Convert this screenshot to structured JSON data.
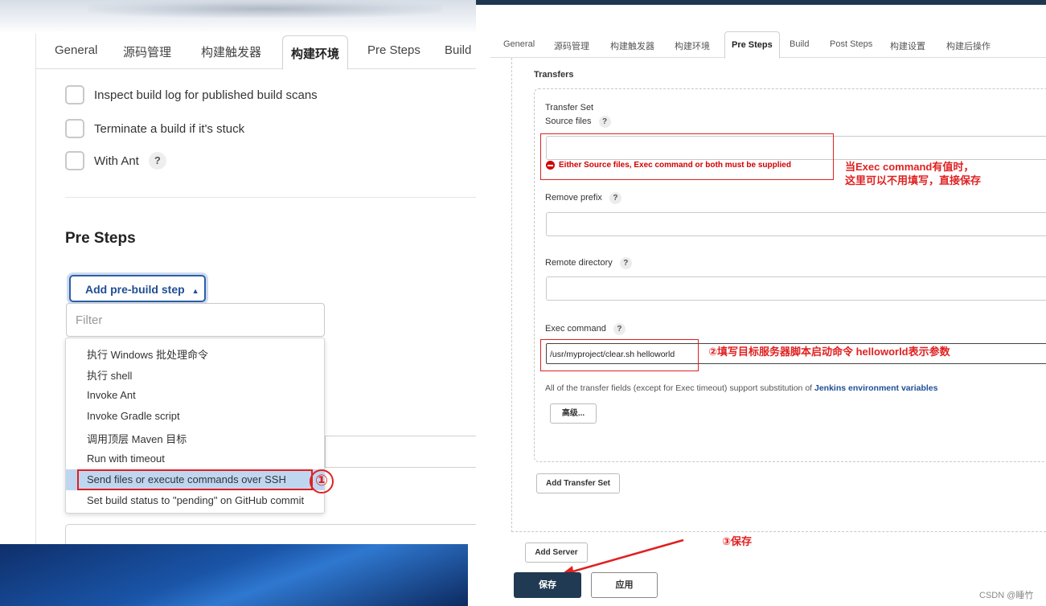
{
  "left": {
    "tabs": [
      "General",
      "源码管理",
      "构建触发器",
      "构建环境",
      "Pre Steps",
      "Build"
    ],
    "checkboxes": [
      "Inspect build log for published build scans",
      "Terminate a build if it's stuck",
      "With Ant"
    ],
    "with_ant_help": "?",
    "section_title": "Pre Steps",
    "add_step_label": "Add pre-build step",
    "filter_placeholder": "Filter",
    "menu_items": [
      "执行 Windows 批处理命令",
      "执行 shell",
      "Invoke Ant",
      "Invoke Gradle script",
      "调用顶层 Maven 目标",
      "Run with timeout",
      "Send files or execute commands over SSH",
      "Set build status to \"pending\" on GitHub commit"
    ],
    "annotation_1": "①"
  },
  "right": {
    "tabs": [
      "General",
      "源码管理",
      "构建触发器",
      "构建环境",
      "Pre Steps",
      "Build",
      "Post Steps",
      "构建设置",
      "构建后操作"
    ],
    "transfers_label": "Transfers",
    "transfer_set_label": "Transfer Set",
    "source_files_label": "Source files",
    "error_message": "Either Source files, Exec command or both must be supplied",
    "annotation_source_line1": "当Exec command有值时，",
    "annotation_source_line2": "这里可以不用填写，直接保存",
    "remove_prefix_label": "Remove prefix",
    "remote_directory_label": "Remote directory",
    "exec_command_label": "Exec command",
    "exec_command_value": "/usr/myproject/clear.sh  helloworld",
    "annotation_exec": "②填写目标服务器脚本启动命令  helloworld表示参数",
    "note_prefix": "All of the transfer fields (except for Exec timeout) support substitution of ",
    "note_link": "Jenkins environment variables",
    "advanced_label": "高级...",
    "add_transfer_set_label": "Add Transfer Set",
    "add_server_label": "Add Server",
    "annotation_save": "③保存",
    "save_label": "保存",
    "apply_label": "应用",
    "help": "?",
    "watermark": "CSDN @睡竹"
  },
  "colors": {
    "annotation_red": "#e02020",
    "save_button": "#1f3a52",
    "link_blue": "#1f4e96",
    "menu_highlight": "#bfd6f1"
  }
}
